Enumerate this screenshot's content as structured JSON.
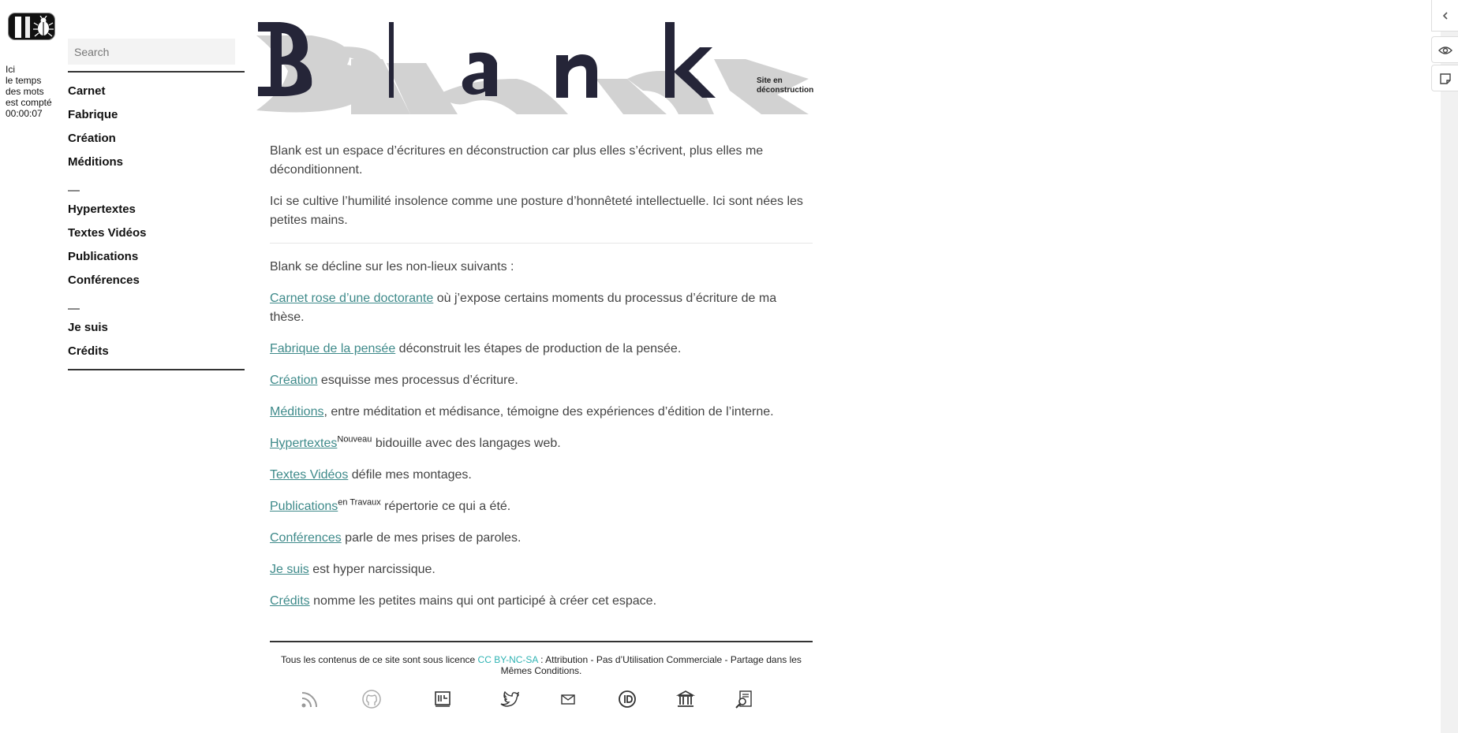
{
  "logo": {
    "icon": "beetle-logo-icon"
  },
  "timer": {
    "lines": [
      "Ici",
      "le temps",
      "des mots",
      "est compté",
      "00:00:07"
    ]
  },
  "search": {
    "placeholder": "Search",
    "value": ""
  },
  "nav": {
    "items": [
      {
        "label": "Carnet"
      },
      {
        "label": "Fabrique"
      },
      {
        "label": "Création"
      },
      {
        "label": "Méditions"
      },
      {
        "label": "Hypertextes"
      },
      {
        "label": "Textes Vidéos"
      },
      {
        "label": "Publications"
      },
      {
        "label": "Conférences"
      },
      {
        "label": "Je suis"
      },
      {
        "label": "Crédits"
      }
    ],
    "separator": "—"
  },
  "header": {
    "title": "Blank",
    "subtitle_line1": "Site en",
    "subtitle_line2": "déconstruction"
  },
  "intro": {
    "p1": "Blank est un espace d’écritures en déconstruction car plus elles s’écrivent, plus elles me déconditionnent.",
    "p2": "Ici se cultive l’humilité insolence comme une posture d’honnêteté intellectuelle. Ici sont nées les petites mains."
  },
  "list_intro": "Blank se décline sur les non-lieux suivants :",
  "entries": [
    {
      "link": "Carnet rose d’une doctorante",
      "sup": "",
      "text": " où j’expose certains moments du processus d’écriture de ma thèse."
    },
    {
      "link": "Fabrique de la pensée",
      "sup": "",
      "text": " déconstruit les étapes de production de la pensée."
    },
    {
      "link": "Création",
      "sup": "",
      "text": " esquisse mes processus d’écriture."
    },
    {
      "link": "Méditions",
      "sup": "",
      "text": ", entre méditation et médisance, témoigne des expériences d’édition de l’interne."
    },
    {
      "link": "Hypertextes",
      "sup": "Nouveau",
      "text": " bidouille avec des langages web."
    },
    {
      "link": "Textes Vidéos",
      "sup": "",
      "text": " défile mes montages."
    },
    {
      "link": "Publications",
      "sup": "en Travaux",
      "text": " répertorie ce qui a été."
    },
    {
      "link": "Conférences",
      "sup": "",
      "text": " parle de mes prises de paroles."
    },
    {
      "link": "Je suis",
      "sup": "",
      "text": " est hyper narcissique."
    },
    {
      "link": "Crédits",
      "sup": "",
      "text": " nomme les petites mains qui ont participé à créer cet espace."
    }
  ],
  "footer": {
    "prefix": "Tous les contenus de ce site sont sous licence ",
    "license_link": "CC BY-NC-SA",
    "suffix": " : Attribution - Pas d’Utilisation Commerciale - Partage dans les Mêmes Conditions.",
    "accent": "#2fb3b3"
  },
  "social_icons": [
    "rss-icon",
    "github-icon",
    "hal-icon",
    "twitter-icon",
    "mail-icon",
    "orcid-icon",
    "institution-icon",
    "research-search-icon"
  ],
  "rail": {
    "icons": [
      "collapse-chevron-icon",
      "eye-icon",
      "note-icon"
    ]
  },
  "colors": {
    "link": "#3e8a8a",
    "text": "#444444",
    "title_dark": "#252538",
    "title_shadow": "#cfcfcf"
  }
}
